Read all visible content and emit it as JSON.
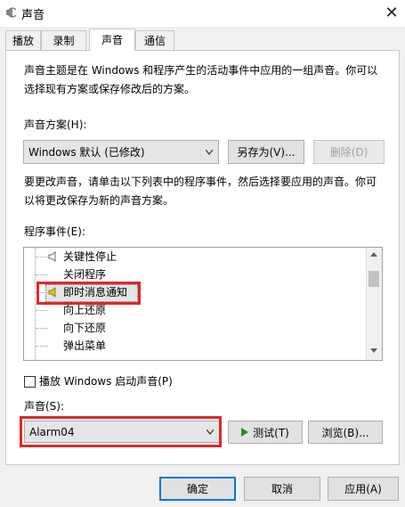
{
  "window": {
    "title": "声音",
    "close_glyph": "✕"
  },
  "tabs": [
    {
      "label": "播放"
    },
    {
      "label": "录制"
    },
    {
      "label": "声音"
    },
    {
      "label": "通信"
    }
  ],
  "active_tab": "声音",
  "scheme_section": {
    "description": "声音主题是在 Windows 和程序产生的活动事件中应用的一组声音。你可以选择现有方案或保存修改后的方案。",
    "label": "声音方案(H):",
    "selected": "Windows 默认 (已修改)",
    "save_as_label": "另存为(V)...",
    "delete_label": "删除(D)"
  },
  "events_section": {
    "description": "要更改声音，请单击以下列表中的程序事件，然后选择要应用的声音。你可以将更改保存为新的声音方案。",
    "label": "程序事件(E):",
    "items": [
      {
        "label": "关键性停止",
        "has_sound": true
      },
      {
        "label": "关闭程序",
        "has_sound": false
      },
      {
        "label": "即时消息通知",
        "has_sound": true,
        "selected": true
      },
      {
        "label": "向上还原",
        "has_sound": false
      },
      {
        "label": "向下还原",
        "has_sound": false
      },
      {
        "label": "弹出菜单",
        "has_sound": false
      }
    ]
  },
  "startup_sound": {
    "label": "播放 Windows 启动声音(P)",
    "checked": false
  },
  "sound_section": {
    "label": "声音(S):",
    "selected": "Alarm04",
    "test_label": "测试(T)",
    "browse_label": "浏览(B)..."
  },
  "footer": {
    "ok_label": "确定",
    "cancel_label": "取消",
    "apply_label": "应用(A)"
  },
  "colors": {
    "highlight_box": "#e1262b",
    "primary_border": "#0078d7",
    "play_icon": "#1b8f1b",
    "speaker_active": "#e6c400"
  }
}
